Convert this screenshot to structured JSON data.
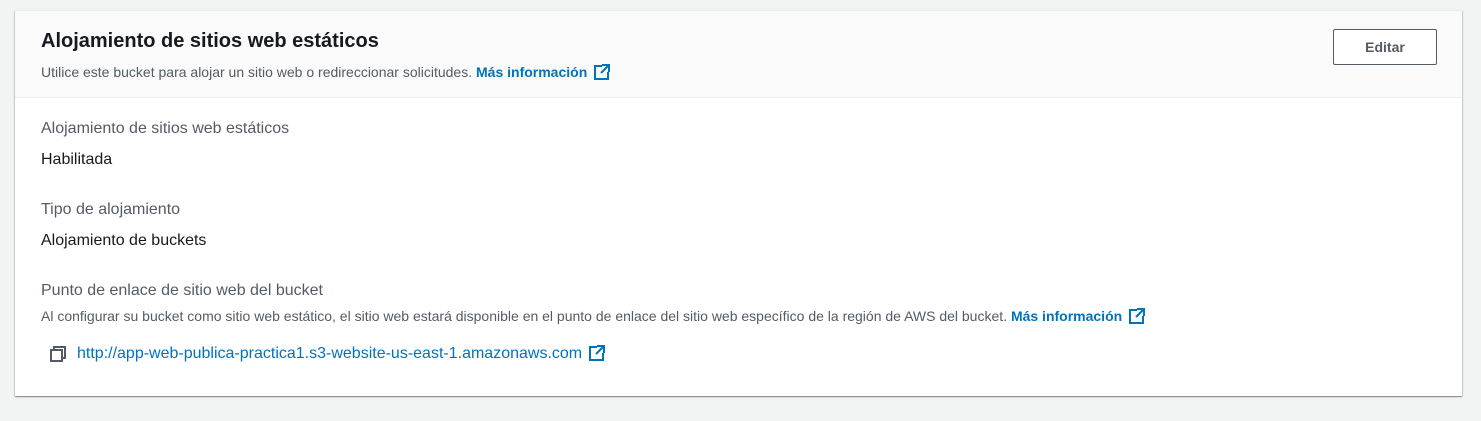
{
  "panel": {
    "title": "Alojamiento de sitios web estáticos",
    "description": "Utilice este bucket para alojar un sitio web o redireccionar solicitudes.",
    "learn_more": "Más información",
    "edit_label": "Editar"
  },
  "fields": {
    "hosting": {
      "label": "Alojamiento de sitios web estáticos",
      "value": "Habilitada"
    },
    "hosting_type": {
      "label": "Tipo de alojamiento",
      "value": "Alojamiento de buckets"
    },
    "endpoint": {
      "label": "Punto de enlace de sitio web del bucket",
      "description": "Al configurar su bucket como sitio web estático, el sitio web estará disponible en el punto de enlace del sitio web específico de la región de AWS del bucket.",
      "learn_more": "Más información",
      "url": "http://app-web-publica-practica1.s3-website-us-east-1.amazonaws.com"
    }
  },
  "icons": {
    "external_link": "external-link-icon",
    "copy": "copy-icon"
  },
  "colors": {
    "link": "#0073bb",
    "text_primary": "#16191f",
    "text_secondary": "#545b64",
    "background": "#f2f3f3"
  }
}
